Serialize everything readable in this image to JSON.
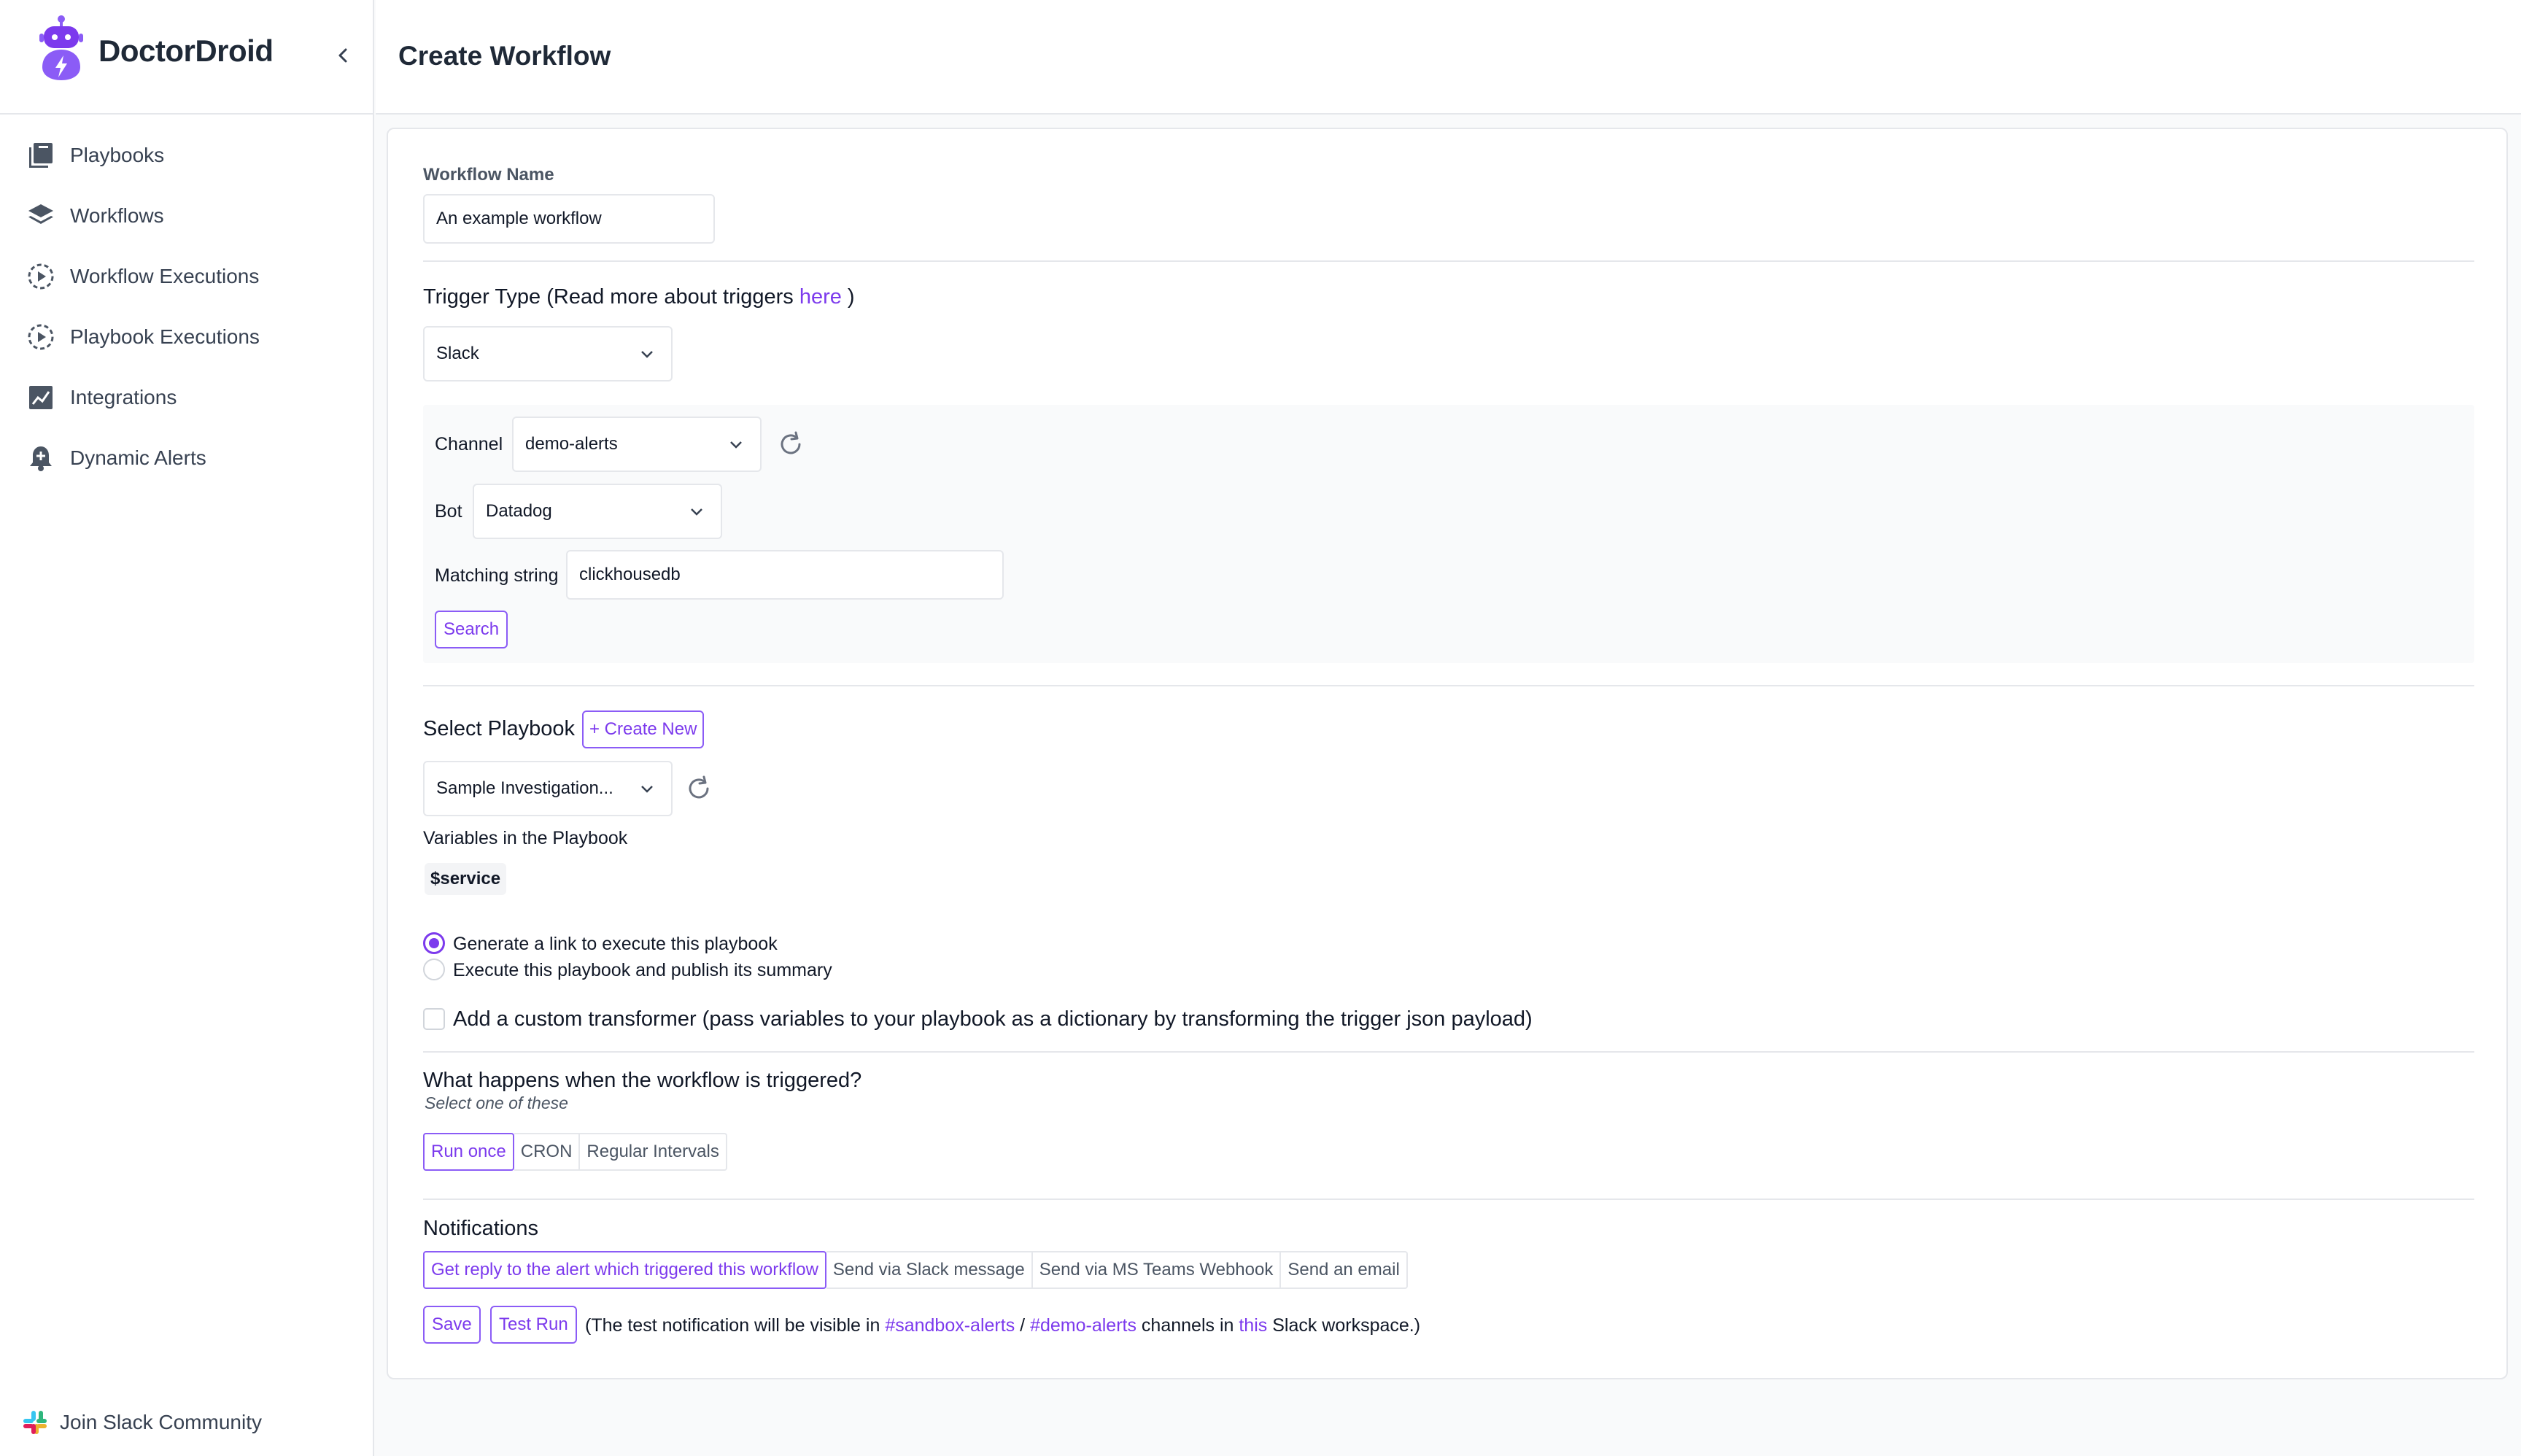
{
  "brand": {
    "name": "DoctorDroid"
  },
  "sidebar": {
    "items": [
      {
        "label": "Playbooks",
        "icon": "book-stack-icon"
      },
      {
        "label": "Workflows",
        "icon": "layers-icon"
      },
      {
        "label": "Workflow Executions",
        "icon": "play-circle-icon"
      },
      {
        "label": "Playbook Executions",
        "icon": "play-circle-icon"
      },
      {
        "label": "Integrations",
        "icon": "chart-icon"
      },
      {
        "label": "Dynamic Alerts",
        "icon": "bell-icon"
      }
    ],
    "footer_link": "Join Slack Community"
  },
  "header": {
    "title": "Create Workflow"
  },
  "form": {
    "workflow_name_label": "Workflow Name",
    "workflow_name_value": "An example workflow",
    "trigger_type_label_prefix": "Trigger Type (Read more about triggers",
    "trigger_type_link": "here",
    "trigger_type_label_suffix": ")",
    "trigger_type_value": "Slack",
    "channel_label": "Channel",
    "channel_value": "demo-alerts",
    "bot_label": "Bot",
    "bot_value": "Datadog",
    "matching_label": "Matching string",
    "matching_value": "clickhousedb",
    "search_button": "Search",
    "select_playbook_label": "Select Playbook",
    "create_new_button": "+ Create New",
    "playbook_value": "Sample Investigation...",
    "variables_label": "Variables in the Playbook",
    "variables": [
      "$service"
    ],
    "radio_generate_link": "Generate a link to execute this playbook",
    "radio_execute_publish": "Execute this playbook and publish its summary",
    "custom_transformer_label": "Add a custom transformer (pass variables to your playbook as a dictionary by transforming the trigger json payload)",
    "schedule_heading": "What happens when the workflow is triggered?",
    "schedule_subtitle": "Select one of these",
    "schedule_options": [
      "Run once",
      "CRON",
      "Regular Intervals"
    ],
    "notifications_heading": "Notifications",
    "notification_options": [
      "Get reply to the alert which triggered this workflow",
      "Send via Slack message",
      "Send via MS Teams Webhook",
      "Send an email"
    ],
    "save_button": "Save",
    "test_run_button": "Test Run",
    "test_note_prefix": "(The test notification will be visible in",
    "test_note_channel_1": "#sandbox-alerts",
    "test_note_sep": "/",
    "test_note_channel_2": "#demo-alerts",
    "test_note_mid": "channels in",
    "test_note_link": "this",
    "test_note_suffix": "Slack workspace.)"
  },
  "colors": {
    "accent": "#7c3aed",
    "border": "#e5e7eb",
    "background": "#f9fafb"
  }
}
